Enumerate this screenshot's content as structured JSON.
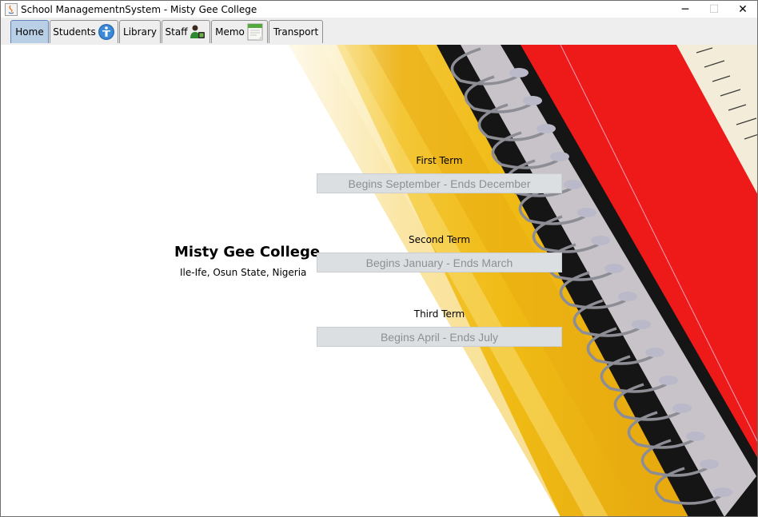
{
  "window": {
    "title": "School ManagementnSystem - Misty Gee College",
    "minimize_glyph": "─",
    "maximize_glyph": "☐",
    "close_glyph": "✕"
  },
  "tabs": [
    {
      "label": "Home",
      "selected": true,
      "icon": ""
    },
    {
      "label": "Students",
      "selected": false,
      "icon": "info-person-icon"
    },
    {
      "label": "Library",
      "selected": false,
      "icon": ""
    },
    {
      "label": "Staff",
      "selected": false,
      "icon": "staff-person-icon"
    },
    {
      "label": "Memo",
      "selected": false,
      "icon": "memo-calendar-icon"
    },
    {
      "label": "Transport",
      "selected": false,
      "icon": ""
    }
  ],
  "college": {
    "name": "Misty Gee College",
    "location": "Ile-Ife, Osun State, Nigeria"
  },
  "terms": [
    {
      "label": "First Term",
      "value": "Begins September - Ends December"
    },
    {
      "label": "Second Term",
      "value": "Begins January - Ends March"
    },
    {
      "label": "Third Term",
      "value": "Begins April - Ends July"
    }
  ],
  "colors": {
    "selected_tab": "#b8cfe5",
    "field_bg": "#dcdfe2",
    "field_text": "#8d8f92",
    "notebook_red": "#ee1a1a",
    "folder_yellow": "#f2c21c"
  }
}
